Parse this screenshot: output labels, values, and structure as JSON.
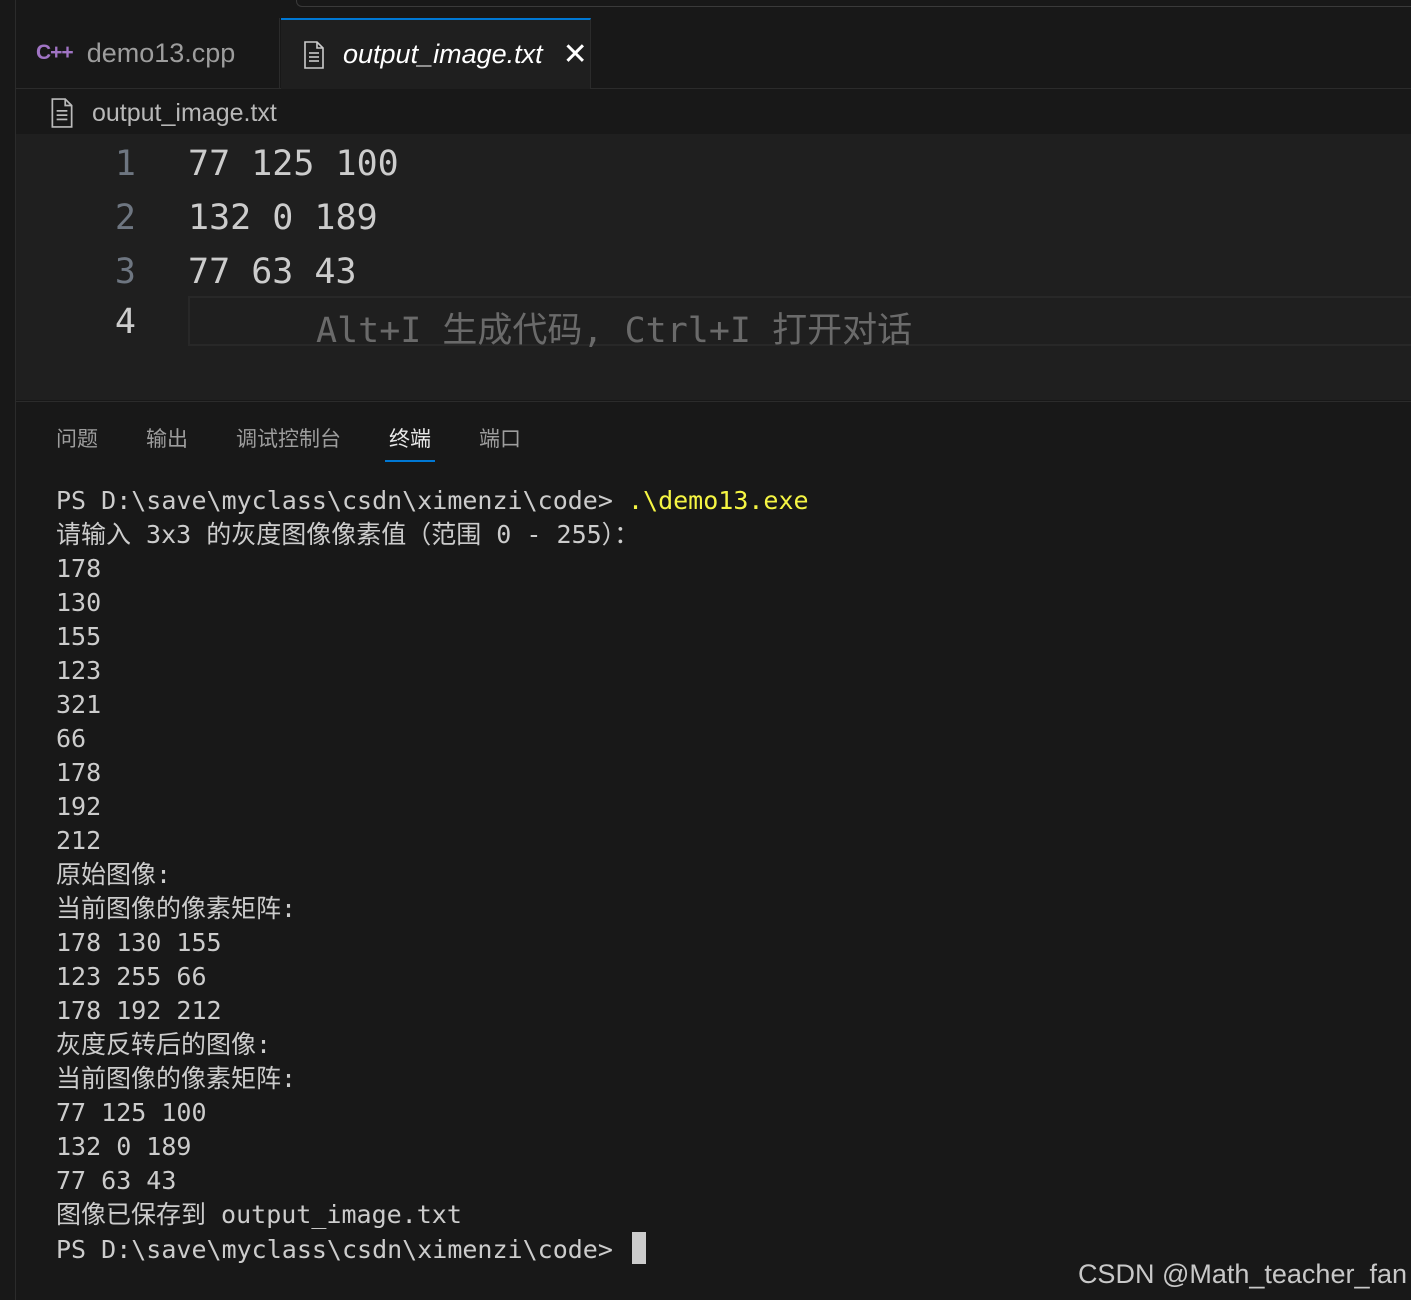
{
  "tabs": [
    {
      "icon": "cpp-file-icon",
      "icon_text": "C++",
      "label": "demo13.cpp",
      "active": false
    },
    {
      "icon": "text-file-icon",
      "label": "output_image.txt",
      "active": true,
      "close": "✕"
    }
  ],
  "breadcrumb": {
    "label": "output_image.txt"
  },
  "editor": {
    "lines": [
      {
        "num": "1",
        "text": "77 125 100"
      },
      {
        "num": "2",
        "text": "132 0 189"
      },
      {
        "num": "3",
        "text": "77 63 43"
      },
      {
        "num": "4",
        "text": "",
        "hint": "Alt+I 生成代码, Ctrl+I 打开对话"
      }
    ]
  },
  "panel": {
    "tabs": [
      "问题",
      "输出",
      "调试控制台",
      "终端",
      "端口"
    ],
    "active_tab": "终端"
  },
  "terminal": {
    "prompt": "PS D:\\save\\myclass\\csdn\\ximenzi\\code>",
    "command": ".\\demo13.exe",
    "output": [
      "请输入 3x3 的灰度图像像素值（范围 0 - 255）：",
      "178",
      "130",
      "155",
      "123",
      "321",
      "66",
      "178",
      "192",
      "212",
      "原始图像:",
      "当前图像的像素矩阵:",
      "178 130 155",
      "123 255 66",
      "178 192 212",
      "灰度反转后的图像:",
      "当前图像的像素矩阵:",
      "77 125 100",
      "132 0 189",
      "77 63 43",
      "图像已保存到 output_image.txt"
    ]
  },
  "watermark": "CSDN @Math_teacher_fan",
  "colors": {
    "accent": "#0078d4",
    "command": "#f5f543",
    "cpp_icon": "#a074c4"
  }
}
